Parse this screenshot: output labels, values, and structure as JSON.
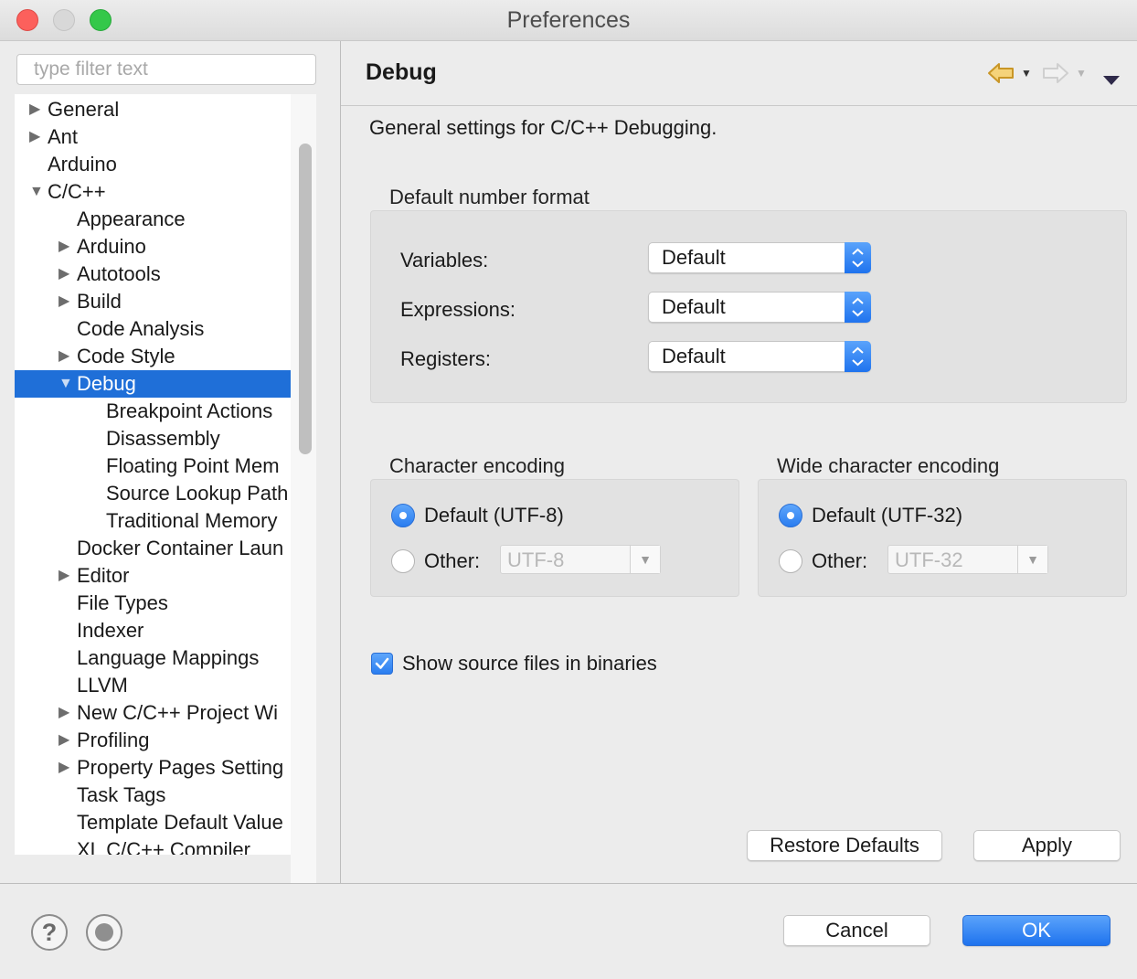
{
  "window": {
    "title": "Preferences"
  },
  "sidebar": {
    "filter_placeholder": "type filter text",
    "tree": [
      {
        "label": "General",
        "level": 0,
        "twisty": "collapsed"
      },
      {
        "label": "Ant",
        "level": 0,
        "twisty": "collapsed"
      },
      {
        "label": "Arduino",
        "level": 0,
        "twisty": "none"
      },
      {
        "label": "C/C++",
        "level": 0,
        "twisty": "expanded"
      },
      {
        "label": "Appearance",
        "level": 1,
        "twisty": "none"
      },
      {
        "label": "Arduino",
        "level": 1,
        "twisty": "collapsed"
      },
      {
        "label": "Autotools",
        "level": 1,
        "twisty": "collapsed"
      },
      {
        "label": "Build",
        "level": 1,
        "twisty": "collapsed"
      },
      {
        "label": "Code Analysis",
        "level": 1,
        "twisty": "none"
      },
      {
        "label": "Code Style",
        "level": 1,
        "twisty": "collapsed"
      },
      {
        "label": "Debug",
        "level": 1,
        "twisty": "expanded",
        "selected": true
      },
      {
        "label": "Breakpoint Actions",
        "level": 2,
        "twisty": "none"
      },
      {
        "label": "Disassembly",
        "level": 2,
        "twisty": "none"
      },
      {
        "label": "Floating Point Mem",
        "level": 2,
        "twisty": "none"
      },
      {
        "label": "Source Lookup Path",
        "level": 2,
        "twisty": "none"
      },
      {
        "label": "Traditional Memory",
        "level": 2,
        "twisty": "none"
      },
      {
        "label": "Docker Container Laun",
        "level": 1,
        "twisty": "none"
      },
      {
        "label": "Editor",
        "level": 1,
        "twisty": "collapsed"
      },
      {
        "label": "File Types",
        "level": 1,
        "twisty": "none"
      },
      {
        "label": "Indexer",
        "level": 1,
        "twisty": "none"
      },
      {
        "label": "Language Mappings",
        "level": 1,
        "twisty": "none"
      },
      {
        "label": "LLVM",
        "level": 1,
        "twisty": "none"
      },
      {
        "label": "New C/C++ Project Wi",
        "level": 1,
        "twisty": "collapsed"
      },
      {
        "label": "Profiling",
        "level": 1,
        "twisty": "collapsed"
      },
      {
        "label": "Property Pages Setting",
        "level": 1,
        "twisty": "collapsed"
      },
      {
        "label": "Task Tags",
        "level": 1,
        "twisty": "none"
      },
      {
        "label": "Template Default Value",
        "level": 1,
        "twisty": "none"
      },
      {
        "label": "XL C/C++ Compiler",
        "level": 1,
        "twisty": "none"
      }
    ]
  },
  "page": {
    "title": "Debug",
    "description": "General settings for C/C++ Debugging.",
    "number_format": {
      "title": "Default number format",
      "variables_label": "Variables:",
      "variables_value": "Default",
      "expressions_label": "Expressions:",
      "expressions_value": "Default",
      "registers_label": "Registers:",
      "registers_value": "Default"
    },
    "char_encoding": {
      "title": "Character encoding",
      "default_label": "Default (UTF-8)",
      "other_label": "Other:",
      "other_value": "UTF-8"
    },
    "wide_encoding": {
      "title": "Wide character encoding",
      "default_label": "Default (UTF-32)",
      "other_label": "Other:",
      "other_value": "UTF-32"
    },
    "show_source_label": "Show source files in binaries",
    "restore_defaults_label": "Restore Defaults",
    "apply_label": "Apply"
  },
  "footer": {
    "cancel_label": "Cancel",
    "ok_label": "OK"
  },
  "icons": {
    "back": "back-arrow-icon",
    "forward": "forward-arrow-icon",
    "view_menu": "view-menu-icon",
    "help": "help-icon",
    "import_export": "import-export-icon"
  },
  "colors": {
    "accent": "#1f6fd8",
    "button_blue": "#2a7df0",
    "back_arrow": "#e8b84a"
  }
}
